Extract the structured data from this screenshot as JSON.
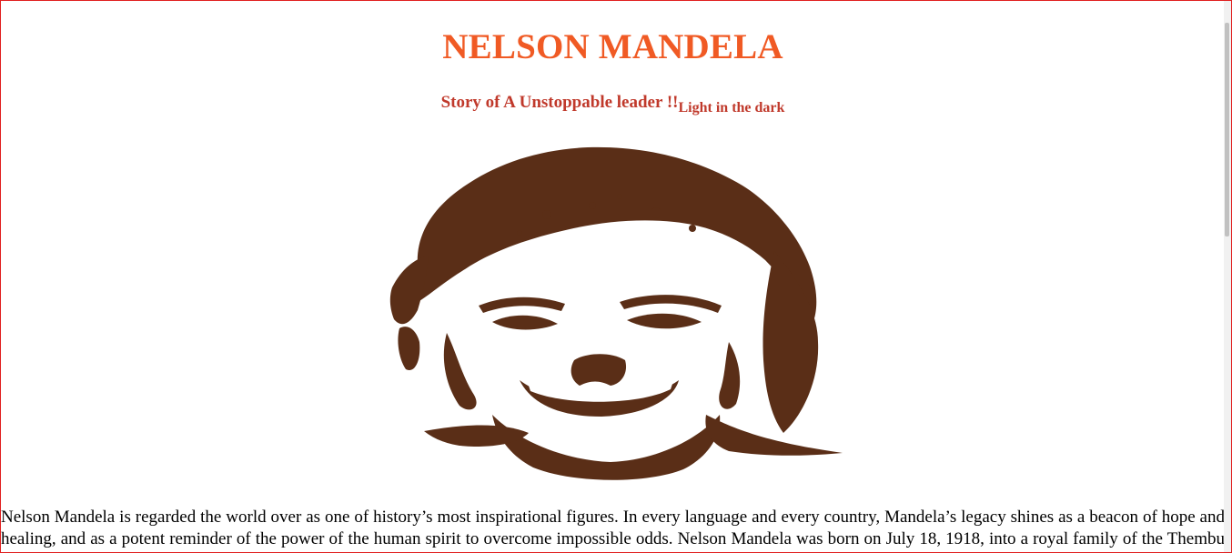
{
  "page": {
    "title": "NELSON MANDELA",
    "subtitle_main": "Story of A Unstoppable leader !!",
    "subtitle_small": "Light in the dark",
    "portrait_image": "nelson-mandela-stencil-portrait",
    "story_text": "Nelson Mandela is regarded the world over as one of history’s most inspirational figures. In every language and every country, Mandela’s legacy shines as a beacon of hope and healing, and as a potent reminder of the power of the human spirit to overcome impossible odds. Nelson Mandela was born on July 18, 1918, into a royal family of the Thembu people."
  },
  "colors": {
    "title": "#f05a24",
    "subtitle": "#c0392b",
    "portrait": "#5a2e17",
    "frame_border": "#e02020"
  }
}
